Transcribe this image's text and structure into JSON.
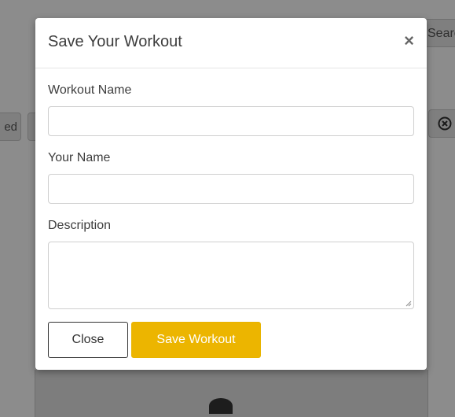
{
  "background": {
    "search_text": "Searc",
    "left_button_text": "ed"
  },
  "modal": {
    "title": "Save Your Workout",
    "close_icon": "×",
    "fields": {
      "workout_name_label": "Workout Name",
      "workout_name_value": "",
      "your_name_label": "Your Name",
      "your_name_value": "",
      "description_label": "Description",
      "description_value": ""
    },
    "buttons": {
      "close_label": "Close",
      "save_label": "Save Workout"
    }
  },
  "colors": {
    "accent": "#ecb500",
    "overlay": "#8c8c8c"
  }
}
